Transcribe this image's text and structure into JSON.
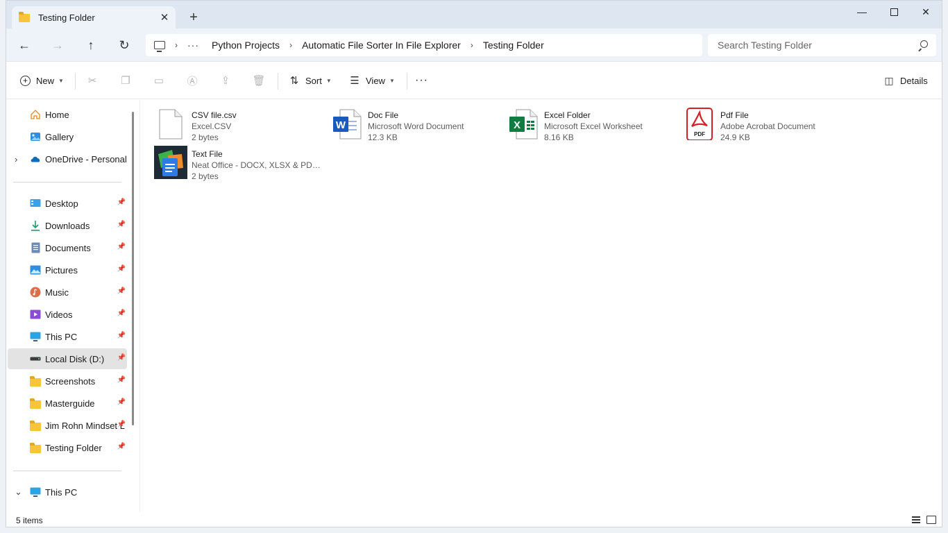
{
  "window": {
    "tab_title": "Testing Folder",
    "tab_close": "✕",
    "new_tab": "+",
    "min": "—",
    "close": "✕"
  },
  "nav": {
    "back": "←",
    "forward": "→",
    "up": "↑",
    "refresh": "↻",
    "more": "···",
    "crumbs": [
      "Python Projects",
      "Automatic File Sorter In File Explorer",
      "Testing Folder"
    ],
    "sep": "›"
  },
  "search": {
    "placeholder": "Search Testing Folder"
  },
  "toolbar": {
    "new_label": "New",
    "sort_label": "Sort",
    "view_label": "View",
    "more": "···",
    "details_label": "Details"
  },
  "sidebar": {
    "top": [
      {
        "label": "Home",
        "icon": "home-icon"
      },
      {
        "label": "Gallery",
        "icon": "gallery-icon"
      },
      {
        "label": "OneDrive - Personal",
        "icon": "onedrive-icon"
      }
    ],
    "quick": [
      {
        "label": "Desktop",
        "icon": "desktop-icon"
      },
      {
        "label": "Downloads",
        "icon": "downloads-icon"
      },
      {
        "label": "Documents",
        "icon": "documents-icon"
      },
      {
        "label": "Pictures",
        "icon": "pictures-icon"
      },
      {
        "label": "Music",
        "icon": "music-icon"
      },
      {
        "label": "Videos",
        "icon": "videos-icon"
      },
      {
        "label": "This PC",
        "icon": "this-pc-icon"
      },
      {
        "label": "Local Disk (D:)",
        "icon": "disk-icon"
      },
      {
        "label": "Screenshots",
        "icon": "folder-icon"
      },
      {
        "label": "Masterguide",
        "icon": "folder-icon"
      },
      {
        "label": "Jim Rohn Mindset L",
        "icon": "folder-icon"
      },
      {
        "label": "Testing Folder",
        "icon": "folder-icon"
      }
    ],
    "this_pc": "This PC",
    "expand": "›",
    "collapse": "⌄",
    "pin": "📌"
  },
  "files": [
    {
      "name": "CSV file.csv",
      "type": "Excel.CSV",
      "size": "2 bytes",
      "icon": "csv-file-icon"
    },
    {
      "name": "Doc File",
      "type": "Microsoft Word Document",
      "size": "12.3 KB",
      "icon": "word-icon"
    },
    {
      "name": "Excel Folder",
      "type": "Microsoft Excel Worksheet",
      "size": "8.16 KB",
      "icon": "excel-icon"
    },
    {
      "name": "Pdf File",
      "type": "Adobe Acrobat Document",
      "size": "24.9 KB",
      "icon": "pdf-icon"
    },
    {
      "name": "Text File",
      "type": "Neat Office - DOCX, XLSX & PDF ...",
      "size": "2 bytes",
      "icon": "neat-office-icon"
    }
  ],
  "icon_text": {
    "word": "W",
    "excel": "X",
    "pdf": "PDF"
  },
  "status": {
    "count": "5 items"
  },
  "colors": {
    "word": "#185abd",
    "excel": "#107c41",
    "pdf": "#d71f26",
    "folder": "#f8c53a"
  }
}
